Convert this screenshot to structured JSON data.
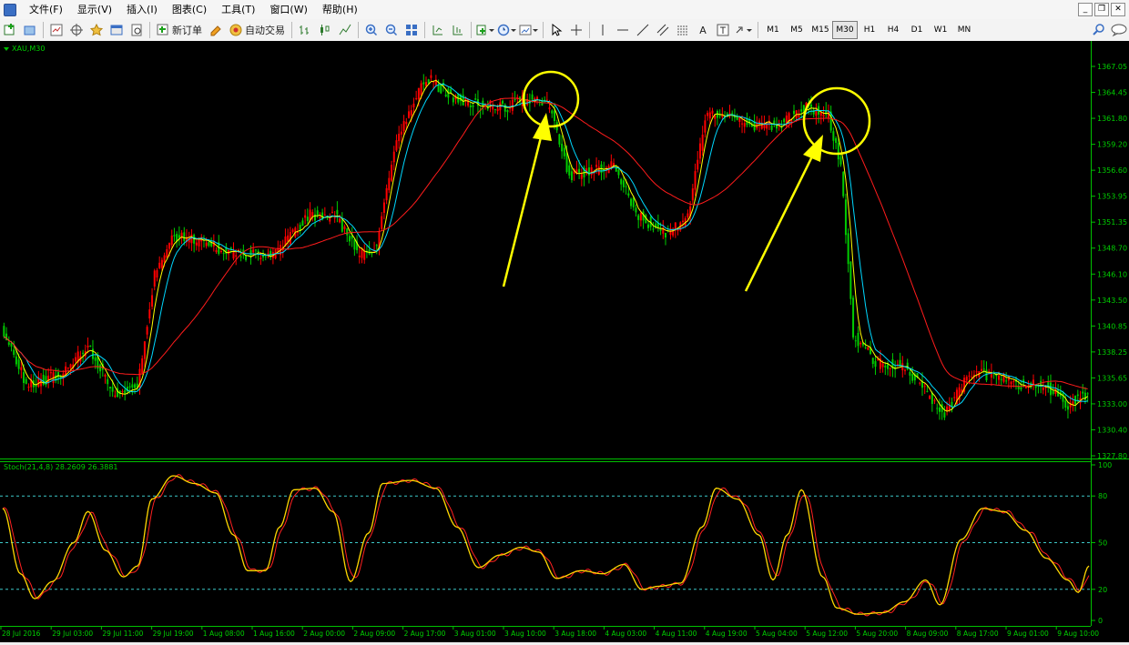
{
  "menu": {
    "items": [
      "文件(F)",
      "显示(V)",
      "插入(I)",
      "图表(C)",
      "工具(T)",
      "窗口(W)",
      "帮助(H)"
    ],
    "window_buttons": [
      "_",
      "❐",
      "✕"
    ]
  },
  "toolbar": {
    "new_order": "新订单",
    "auto_trading": "自动交易",
    "text_tool": "A",
    "timeframes": [
      "M1",
      "M5",
      "M15",
      "M30",
      "H1",
      "H4",
      "D1",
      "W1",
      "MN"
    ],
    "active_timeframe": "M30"
  },
  "chart": {
    "symbol_label": "XAU,M30",
    "price_levels": [
      "1367.05",
      "1364.45",
      "1361.80",
      "1359.20",
      "1356.60",
      "1353.95",
      "1351.35",
      "1348.70",
      "1346.10",
      "1343.50",
      "1340.85",
      "1338.25",
      "1335.65",
      "1333.00",
      "1330.40",
      "1327.80"
    ],
    "indicator_label": "Stoch(21,4,8) 28.2609 26.3881",
    "stoch_levels": [
      "100",
      "80",
      "50",
      "20",
      "0"
    ],
    "time_labels": [
      "28 Jul 2016",
      "29 Jul 03:00",
      "29 Jul 11:00",
      "29 Jul 19:00",
      "1 Aug 08:00",
      "1 Aug 16:00",
      "2 Aug 00:00",
      "2 Aug 09:00",
      "2 Aug 17:00",
      "3 Aug 01:00",
      "3 Aug 10:00",
      "3 Aug 18:00",
      "4 Aug 03:00",
      "4 Aug 11:00",
      "4 Aug 19:00",
      "5 Aug 04:00",
      "5 Aug 12:00",
      "5 Aug 20:00",
      "8 Aug 09:00",
      "8 Aug 17:00",
      "9 Aug 01:00",
      "9 Aug 10:00"
    ],
    "colors": {
      "bull": "#ff0000",
      "bear": "#00cc00",
      "grid": "#00c000",
      "ma_fast": "#ffff00",
      "ma_mid": "#00d8ff",
      "ma_slow": "#ff1c1c",
      "stoch_main": "#ffd700",
      "stoch_signal": "#ff2020",
      "annotation": "#ffff00"
    }
  }
}
